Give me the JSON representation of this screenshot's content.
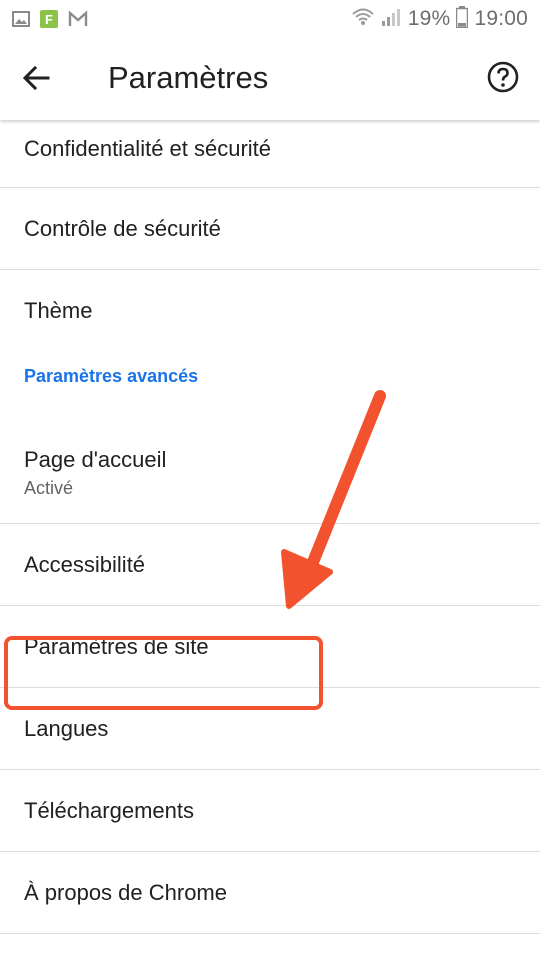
{
  "status_bar": {
    "battery": "19%",
    "time": "19:00",
    "icons": [
      "image-icon",
      "f-app-icon",
      "gmail-icon",
      "wifi-icon",
      "signal-icon",
      "battery-icon"
    ]
  },
  "toolbar": {
    "title": "Paramètres",
    "back_icon": "arrow-back-icon",
    "help_icon": "help-circle-icon"
  },
  "items": {
    "privacy": "Confidentialité et sécurité",
    "safety_check": "Contrôle de sécurité",
    "theme": "Thème",
    "advanced_header": "Paramètres avancés",
    "homepage": "Page d'accueil",
    "homepage_sub": "Activé",
    "accessibility": "Accessibilité",
    "site_settings": "Paramètres de site",
    "languages": "Langues",
    "downloads": "Téléchargements",
    "about": "À propos de Chrome"
  },
  "annotation": {
    "highlight_color": "#f2522e",
    "highlighted_item": "site_settings"
  },
  "colors": {
    "accent": "#1a73e8",
    "annotation": "#f2522e"
  }
}
